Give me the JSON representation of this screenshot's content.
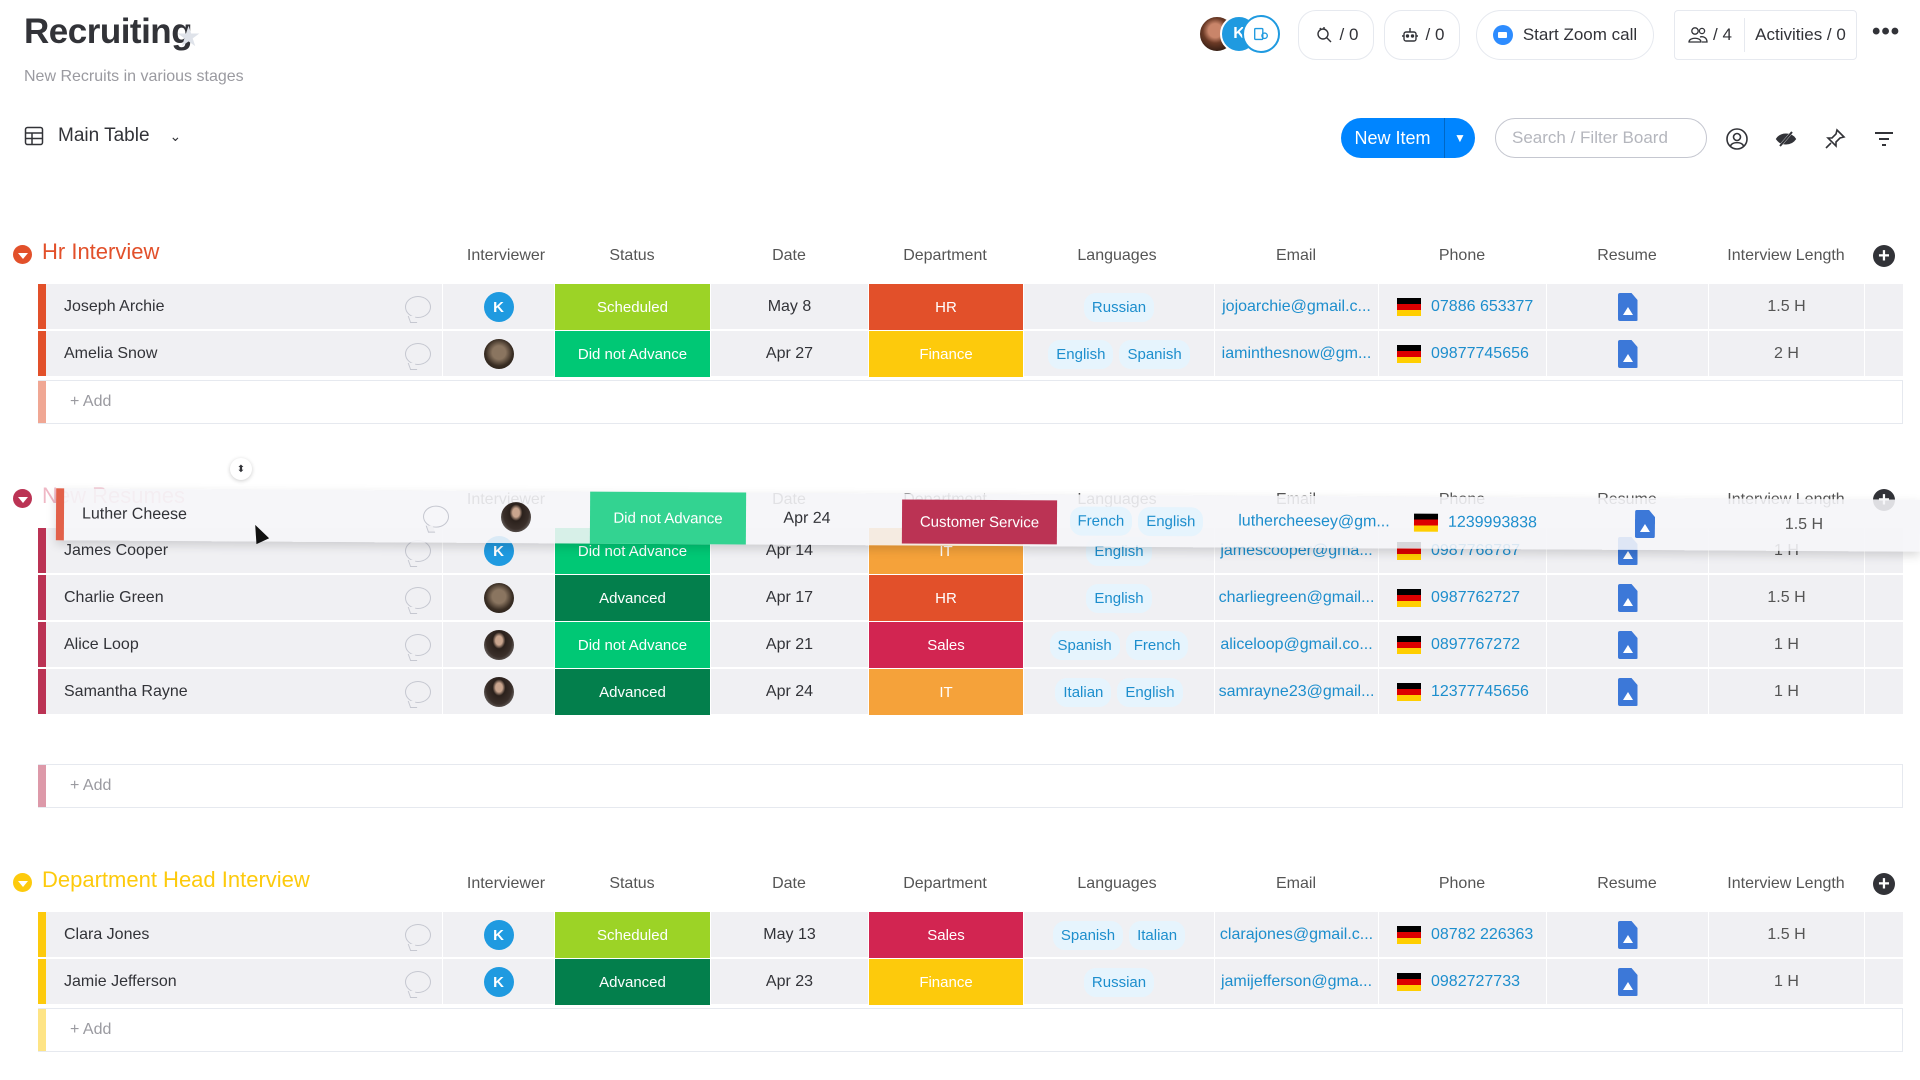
{
  "header": {
    "title": "Recruiting",
    "description": "New Recruits in various stages",
    "avatars": [
      {
        "type": "photo",
        "label": ""
      },
      {
        "type": "initial",
        "label": "K"
      },
      {
        "type": "guest-icon",
        "label": ""
      }
    ],
    "integrations_count": "/ 0",
    "automations_count": "/ 0",
    "zoom_call_label": "Start Zoom call",
    "members_count": "/ 4",
    "activities_label": "Activities / 0",
    "more_label": "•••"
  },
  "toolbar": {
    "view_label": "Main Table",
    "new_item_label": "New Item",
    "search_placeholder": "Search / Filter Board"
  },
  "columns": [
    "Interviewer",
    "Status",
    "Date",
    "Department",
    "Languages",
    "Email",
    "Phone",
    "Resume",
    "Interview Length"
  ],
  "colors": {
    "status": {
      "Scheduled": "#9cd326",
      "Did not Advance": "#00c875",
      "Advanced": "#037f4c"
    },
    "department": {
      "HR": "#e2445c",
      "Finance": "#ffcb00",
      "Sales": "#e2445c",
      "IT": "#fdab3d",
      "Customer Service": "#bb3354"
    }
  },
  "groups": [
    {
      "name": "Hr Interview",
      "color": "#e2445c",
      "add_label": "+ Add",
      "rows": [
        {
          "name": "Joseph Archie",
          "interviewer": "K",
          "status": "Scheduled",
          "date": "May 8",
          "department": "HR",
          "languages": [
            "Russian"
          ],
          "email": "jojoarchie@gmail.c...",
          "phone": "07886 653377",
          "length": "1.5 H"
        },
        {
          "name": "Amelia Snow",
          "interviewer": "dog-photo",
          "status": "Did not Advance",
          "date": "Apr 27",
          "department": "Finance",
          "languages": [
            "English",
            "Spanish"
          ],
          "email": "iaminthesnow@gm...",
          "phone": "09877745656",
          "length": "2 H"
        }
      ]
    },
    {
      "name": "New Resumes",
      "color": "#bb3354",
      "add_label": "+ Add",
      "rows": [
        {
          "name": "James Cooper",
          "interviewer": "K",
          "status": "Did not Advance",
          "date": "Apr 14",
          "department": "IT",
          "languages": [
            "English"
          ],
          "email": "jamescooper@gma...",
          "phone": "0987768787",
          "length": "1 H"
        },
        {
          "name": "Charlie Green",
          "interviewer": "dog-photo",
          "status": "Advanced",
          "date": "Apr 17",
          "department": "HR",
          "languages": [
            "English"
          ],
          "email": "charliegreen@gmail...",
          "phone": "0987762727",
          "length": "1.5 H"
        },
        {
          "name": "Alice Loop",
          "interviewer": "woman-photo",
          "status": "Did not Advance",
          "date": "Apr 21",
          "department": "Sales",
          "languages": [
            "Spanish",
            "French"
          ],
          "email": "aliceloop@gmail.co...",
          "phone": "0897767272",
          "length": "1 H"
        },
        {
          "name": "Samantha Rayne",
          "interviewer": "woman-photo",
          "status": "Advanced",
          "date": "Apr 24",
          "department": "IT",
          "languages": [
            "Italian",
            "English"
          ],
          "email": "samrayne23@gmail...",
          "phone": "12377745656",
          "length": "1 H"
        }
      ]
    },
    {
      "name": "Department Head Interview",
      "color": "#ffcb00",
      "add_label": "+ Add",
      "rows": [
        {
          "name": "Clara Jones",
          "interviewer": "K",
          "status": "Scheduled",
          "date": "May 13",
          "department": "Sales",
          "languages": [
            "Spanish",
            "Italian"
          ],
          "email": "clarajones@gmail.c...",
          "phone": "08782 226363",
          "length": "1.5 H"
        },
        {
          "name": "Jamie Jefferson",
          "interviewer": "K",
          "status": "Advanced",
          "date": "Apr 23",
          "department": "Finance",
          "languages": [
            "Russian"
          ],
          "email": "jamijefferson@gma...",
          "phone": "0982727733",
          "length": "1 H"
        }
      ]
    }
  ],
  "dragged_row": {
    "name": "Luther Cheese",
    "interviewer": "woman-photo",
    "status": "Did not Advance",
    "date": "Apr 24",
    "department": "Customer Service",
    "languages": [
      "French",
      "English"
    ],
    "email": "luthercheesey@gm...",
    "phone": "1239993838",
    "length": "1.5 H"
  }
}
